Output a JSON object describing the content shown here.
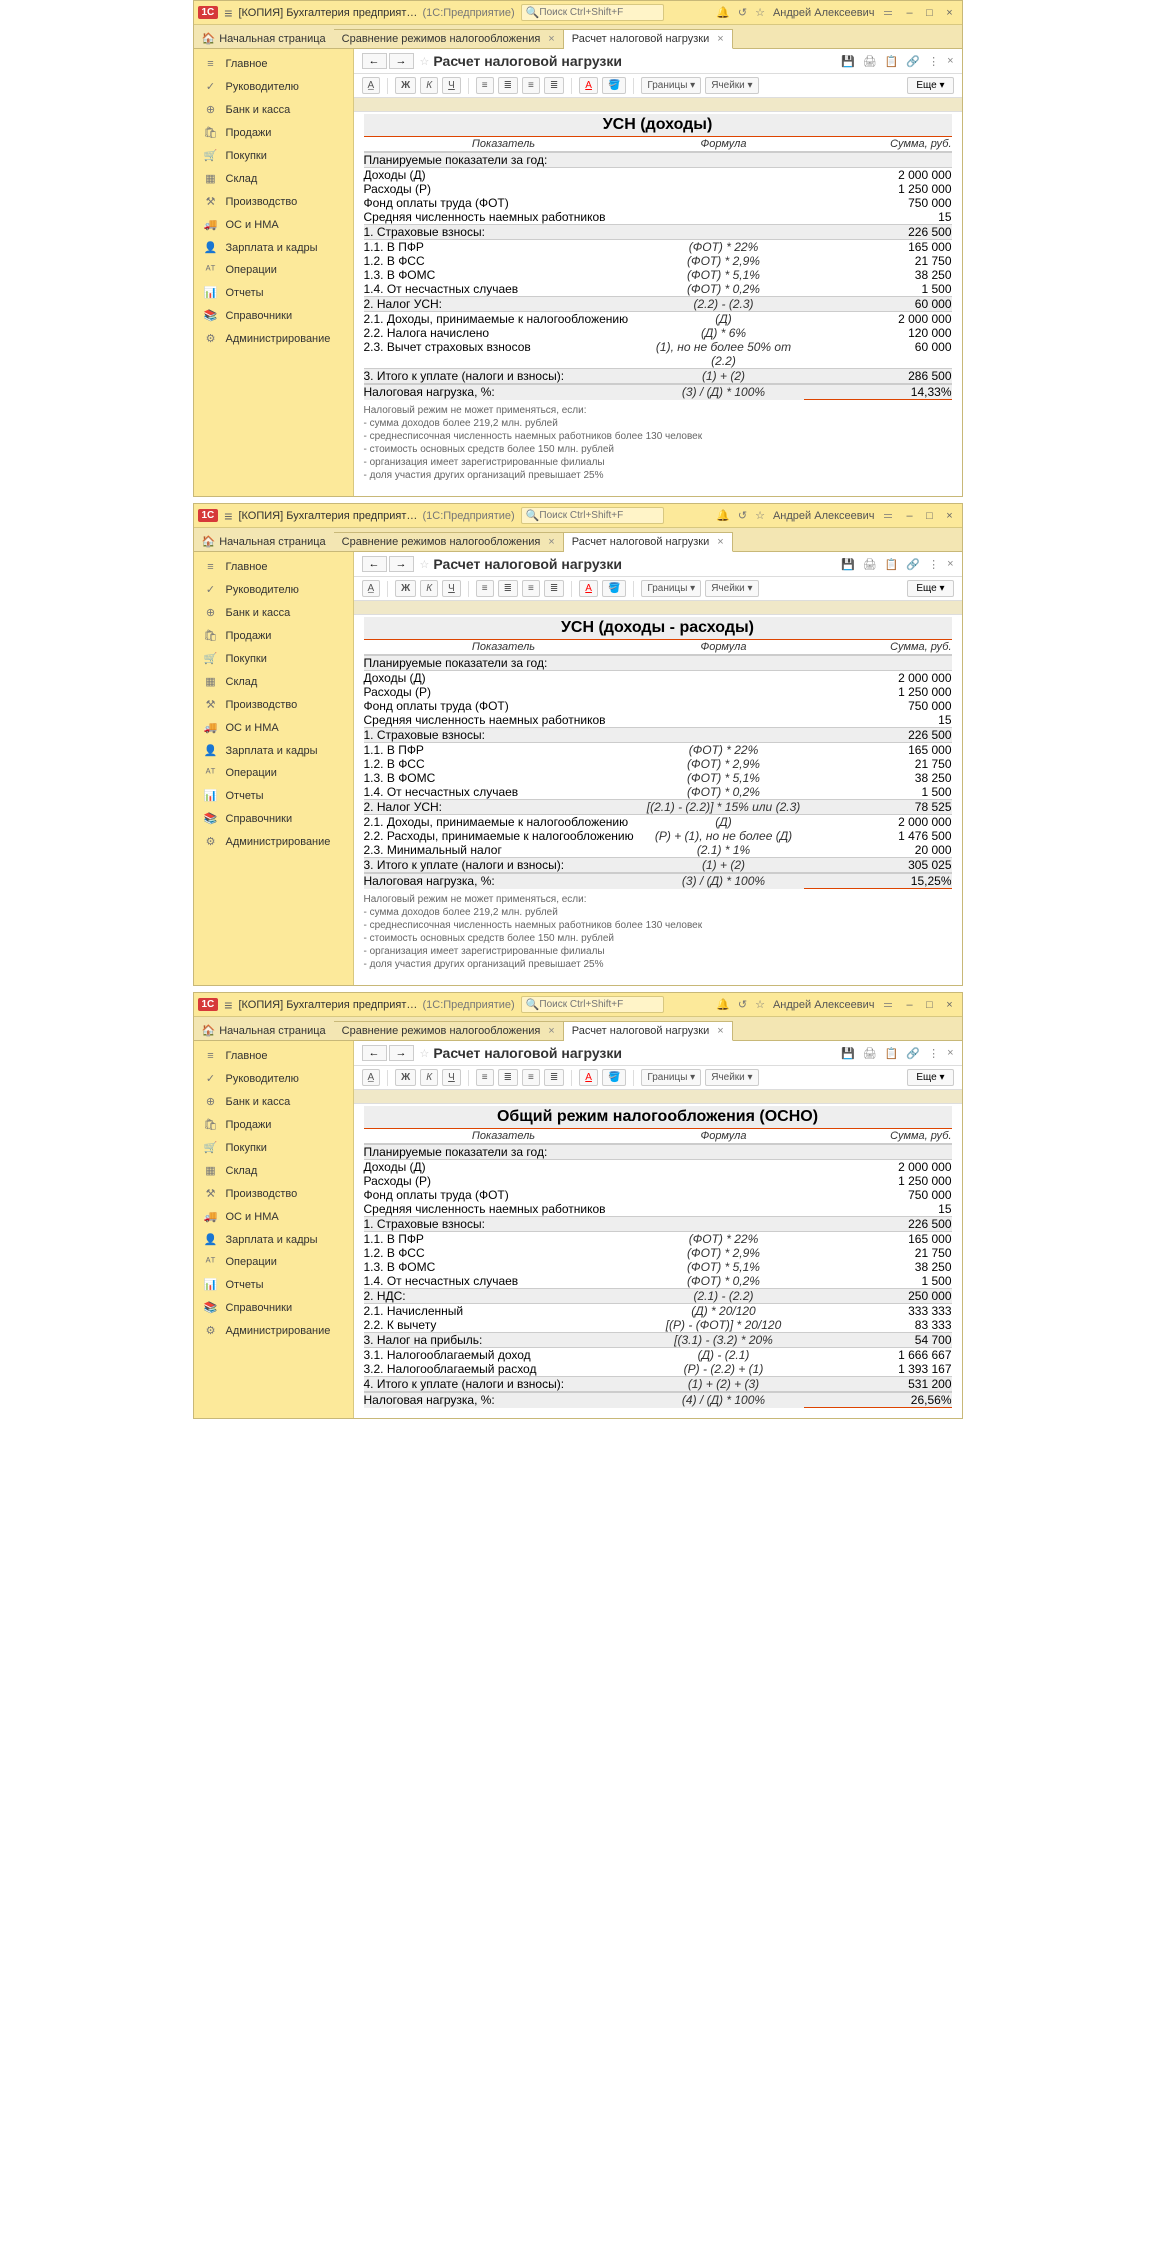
{
  "app": {
    "title": "[КОПИЯ] Бухгалтерия предприятия, редак...",
    "mode": "(1С:Предприятие)",
    "searchPlaceholder": "Поиск Ctrl+Shift+F",
    "user": "Андрей Алексеевич"
  },
  "tabs": {
    "home": "Начальная страница",
    "t1": "Сравнение режимов налогообложения",
    "t2": "Расчет налоговой нагрузки"
  },
  "page": {
    "title": "Расчет налоговой нагрузки",
    "borders": "Границы",
    "cells": "Ячейки",
    "more": "Еще"
  },
  "sidebar": [
    {
      "ic": "≡",
      "t": "Главное"
    },
    {
      "ic": "✓",
      "t": "Руководителю"
    },
    {
      "ic": "⊕",
      "t": "Банк и касса"
    },
    {
      "ic": "🛍",
      "t": "Продажи"
    },
    {
      "ic": "🛒",
      "t": "Покупки"
    },
    {
      "ic": "▦",
      "t": "Склад"
    },
    {
      "ic": "⚒",
      "t": "Производство"
    },
    {
      "ic": "🚚",
      "t": "ОС и НМА"
    },
    {
      "ic": "👤",
      "t": "Зарплата и кадры"
    },
    {
      "ic": "ᴬᵀ",
      "t": "Операции"
    },
    {
      "ic": "📊",
      "t": "Отчеты"
    },
    {
      "ic": "📚",
      "t": "Справочники"
    },
    {
      "ic": "⚙",
      "t": "Администрирование"
    }
  ],
  "colNames": {
    "c1": "Показатель",
    "c2": "Формула",
    "c3": "Сумма, руб."
  },
  "planHeader": "Планируемые показатели за год:",
  "plan": [
    {
      "l": "Доходы (Д)",
      "v": "2 000 000"
    },
    {
      "l": "Расходы (Р)",
      "v": "1 250 000"
    },
    {
      "l": "Фонд оплаты труда (ФОТ)",
      "v": "750 000"
    },
    {
      "l": "Средняя численность наемных работников",
      "v": "15"
    }
  ],
  "insHeader": {
    "l": "1. Страховые взносы:",
    "v": "226 500"
  },
  "ins": [
    {
      "l": "1.1. В ПФР",
      "f": "(ФОТ) * 22%",
      "v": "165 000"
    },
    {
      "l": "1.2. В ФСС",
      "f": "(ФОТ) * 2,9%",
      "v": "21 750"
    },
    {
      "l": "1.3. В ФОМС",
      "f": "(ФОТ) * 5,1%",
      "v": "38 250"
    },
    {
      "l": "1.4. От несчастных случаев",
      "f": "(ФОТ) * 0,2%",
      "v": "1 500"
    }
  ],
  "notes": [
    "Налоговый режим не может применяться, если:",
    "- сумма доходов более 219,2 млн. рублей",
    "- среднесписочная численность наемных работников более 130 человек",
    "- стоимость основных средств более 150 млн. рублей",
    "- организация имеет зарегистрированные филиалы",
    "- доля участия других организаций превышает 25%"
  ],
  "screens": [
    {
      "h": "УСН (доходы)",
      "tax": {
        "l": "2. Налог УСН:",
        "f": "(2.2) - (2.3)",
        "v": "60 000"
      },
      "taxRows": [
        {
          "l": "2.1. Доходы, принимаемые к налогообложению",
          "f": "(Д)",
          "v": "2 000 000"
        },
        {
          "l": "2.2. Налога начислено",
          "f": "(Д) * 6%",
          "v": "120 000"
        },
        {
          "l": "2.3. Вычет страховых взносов",
          "f": "(1), но не более 50% от (2.2)",
          "v": "60 000"
        }
      ],
      "total": {
        "l": "3. Итого к уплате (налоги и взносы):",
        "f": "(1) + (2)",
        "v": "286 500"
      },
      "burden": {
        "l": "Налоговая нагрузка, %:",
        "f": "(3) / (Д) * 100%",
        "v": "14,33%"
      },
      "showNotes": true
    },
    {
      "h": "УСН (доходы - расходы)",
      "tax": {
        "l": "2. Налог УСН:",
        "f": "[(2.1) - (2.2)] * 15% или (2.3)",
        "v": "78 525"
      },
      "taxRows": [
        {
          "l": "2.1. Доходы, принимаемые к налогообложению",
          "f": "(Д)",
          "v": "2 000 000"
        },
        {
          "l": "2.2. Расходы, принимаемые к налогообложению",
          "f": "(Р) + (1), но не более (Д)",
          "v": "1 476 500"
        },
        {
          "l": "2.3. Минимальный налог",
          "f": "(2.1) * 1%",
          "v": "20 000"
        }
      ],
      "total": {
        "l": "3. Итого к уплате (налоги и взносы):",
        "f": "(1) + (2)",
        "v": "305 025"
      },
      "burden": {
        "l": "Налоговая нагрузка, %:",
        "f": "(3) / (Д) * 100%",
        "v": "15,25%"
      },
      "showNotes": true
    },
    {
      "h": "Общий режим налогообложения (ОСНО)",
      "extraSections": [
        {
          "hdr": {
            "l": "2. НДС:",
            "f": "(2.1) - (2.2)",
            "v": "250 000"
          },
          "rows": [
            {
              "l": "2.1. Начисленный",
              "f": "(Д) * 20/120",
              "v": "333 333"
            },
            {
              "l": "2.2. К вычету",
              "f": "[(Р) - (ФОТ)] * 20/120",
              "v": "83 333"
            }
          ]
        },
        {
          "hdr": {
            "l": "3. Налог на прибыль:",
            "f": "[(3.1) - (3.2) * 20%",
            "v": "54 700"
          },
          "rows": [
            {
              "l": "3.1. Налогооблагаемый доход",
              "f": "(Д) - (2.1)",
              "v": "1 666 667"
            },
            {
              "l": "3.2. Налогооблагаемый расход",
              "f": "(Р) - (2.2)  + (1)",
              "v": "1 393 167"
            }
          ]
        }
      ],
      "total": {
        "l": "4. Итого к уплате (налоги и взносы):",
        "f": "(1) + (2) + (3)",
        "v": "531 200"
      },
      "burden": {
        "l": "Налоговая нагрузка, %:",
        "f": "(4) / (Д) * 100%",
        "v": "26,56%"
      },
      "showNotes": false
    }
  ]
}
